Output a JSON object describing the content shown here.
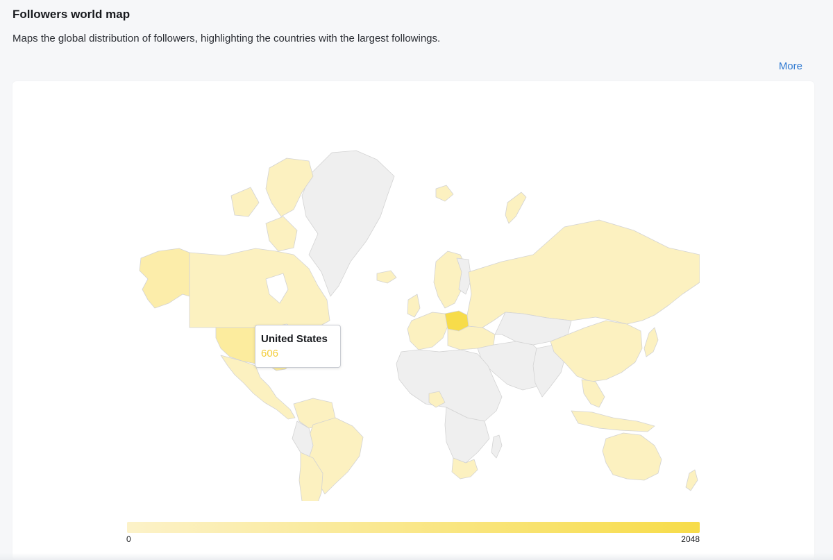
{
  "header": {
    "title": "Followers world map",
    "subtitle": "Maps the global distribution of followers, highlighting the countries with the largest followings.",
    "more_label": "More"
  },
  "tooltip": {
    "country": "United States",
    "value": "606"
  },
  "legend": {
    "min_label": "0",
    "max_label": "2048",
    "min_color": "#fcf2c9",
    "max_color": "#f7dc49"
  },
  "map_data": {
    "type": "choropleth",
    "no_data_color": "#efefef",
    "border_color": "#d6d6d6",
    "scale_min": 0,
    "scale_max": 2048,
    "highlighted": [
      {
        "country": "Poland",
        "level": 0.85
      },
      {
        "country": "United States",
        "level": 0.3
      }
    ],
    "light_fill_countries": [
      "Canada",
      "Alaska (US)",
      "Mexico",
      "Brazil",
      "Argentina",
      "Chile",
      "Peru",
      "Colombia",
      "Venezuela",
      "Russia",
      "China",
      "Kazakhstan",
      "Ukraine",
      "Germany",
      "France",
      "Spain",
      "Italy",
      "United Kingdom",
      "Norway",
      "Sweden",
      "Finland",
      "South Africa",
      "Nigeria",
      "Australia",
      "New Zealand",
      "Japan",
      "Indonesia",
      "Vietnam",
      "Thailand",
      "Philippines",
      "Iceland",
      "Svalbard"
    ]
  }
}
